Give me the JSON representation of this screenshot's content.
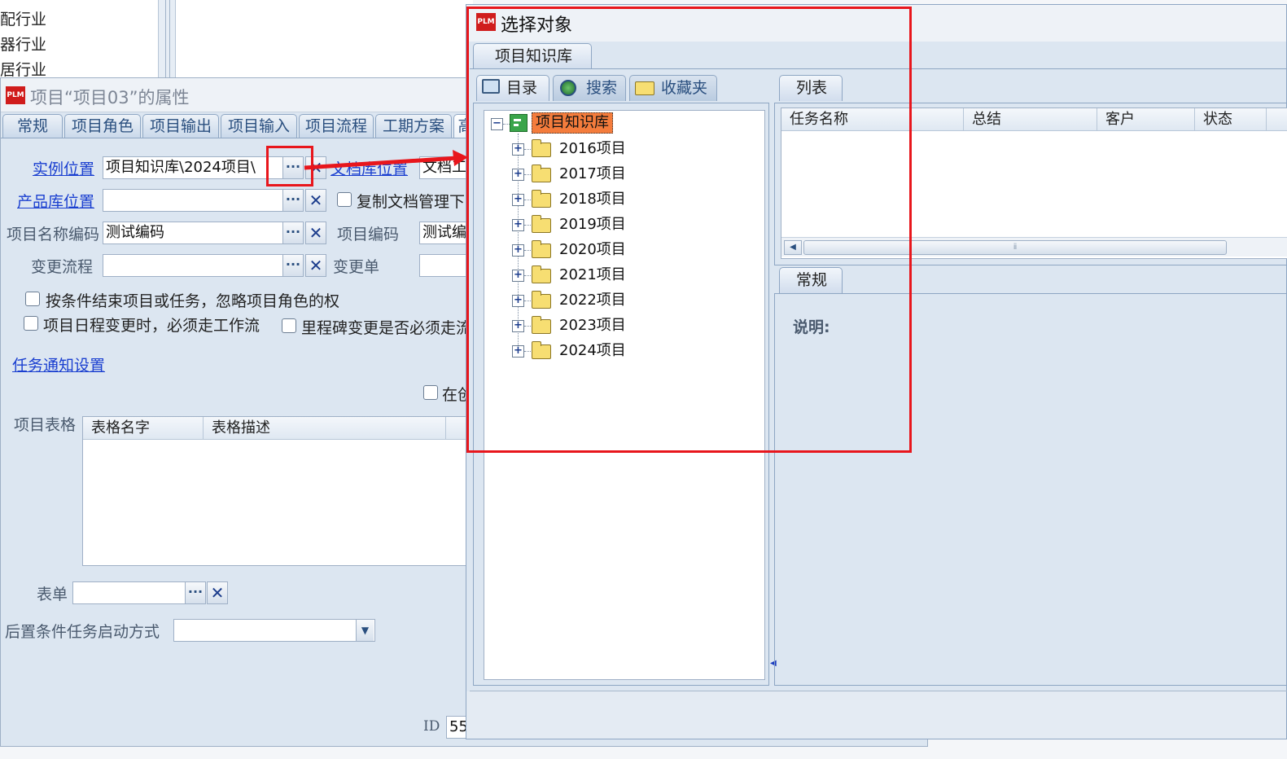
{
  "background_list": {
    "items": [
      "配行业",
      "器行业",
      "居行业"
    ]
  },
  "properties_dialog": {
    "title": "项目“项目03”的属性",
    "app_icon": "PLM",
    "tabs": [
      "常规",
      "项目角色",
      "项目输出",
      "项目输入",
      "项目流程",
      "工期方案",
      "高"
    ],
    "instance_location_label": "实例位置",
    "instance_location_value": "项目知识库\\2024项目\\",
    "doc_library_label": "文档库位置",
    "doc_library_value": "文档工",
    "product_library_label": "产品库位置",
    "product_library_value": "",
    "copy_doc_label": "复制文档管理下",
    "project_name_code_label": "项目名称编码",
    "project_name_code_value": "测试编码",
    "project_code_label": "项目编码",
    "project_code_value": "测试编",
    "change_flow_label": "变更流程",
    "change_flow_value": "",
    "change_form_label": "变更单",
    "cb1_label": "按条件结束项目或任务，忽略项目角色的权",
    "cb2_label": "项目日程变更时，必须走工作流",
    "cb3_label": "里程碑变更是否必须走流",
    "task_notify_link": "任务通知设置",
    "cb4_label": "在创",
    "project_table_label": "项目表格",
    "table_headers": [
      "表格名字",
      "表格描述"
    ],
    "form_label": "表单",
    "form_value": "",
    "post_condition_label": "后置条件任务启动方式",
    "post_condition_value": "",
    "id_label": "ID",
    "id_value": "55",
    "ellipsis": "···",
    "clear": "✕"
  },
  "select_dialog": {
    "title": "选择对象",
    "app_icon": "PLM",
    "outer_tab": "项目知识库",
    "left_tabs": [
      "目录",
      "搜索",
      "收藏夹"
    ],
    "tree_root": "项目知识库",
    "tree_items": [
      "2016项目",
      "2017项目",
      "2018项目",
      "2019项目",
      "2020项目",
      "2021项目",
      "2022项目",
      "2023项目",
      "2024项目"
    ],
    "list_tab": "列表",
    "list_headers": [
      "任务名称",
      "总结",
      "客户",
      "状态"
    ],
    "detail_tab": "常规",
    "description_label": "说明:",
    "scroll_grip": "ⅱ"
  },
  "colors": {
    "annotation_red": "#e8161c",
    "tree_root_highlight": "#f47c3c",
    "link_blue": "#1a3fd0"
  }
}
